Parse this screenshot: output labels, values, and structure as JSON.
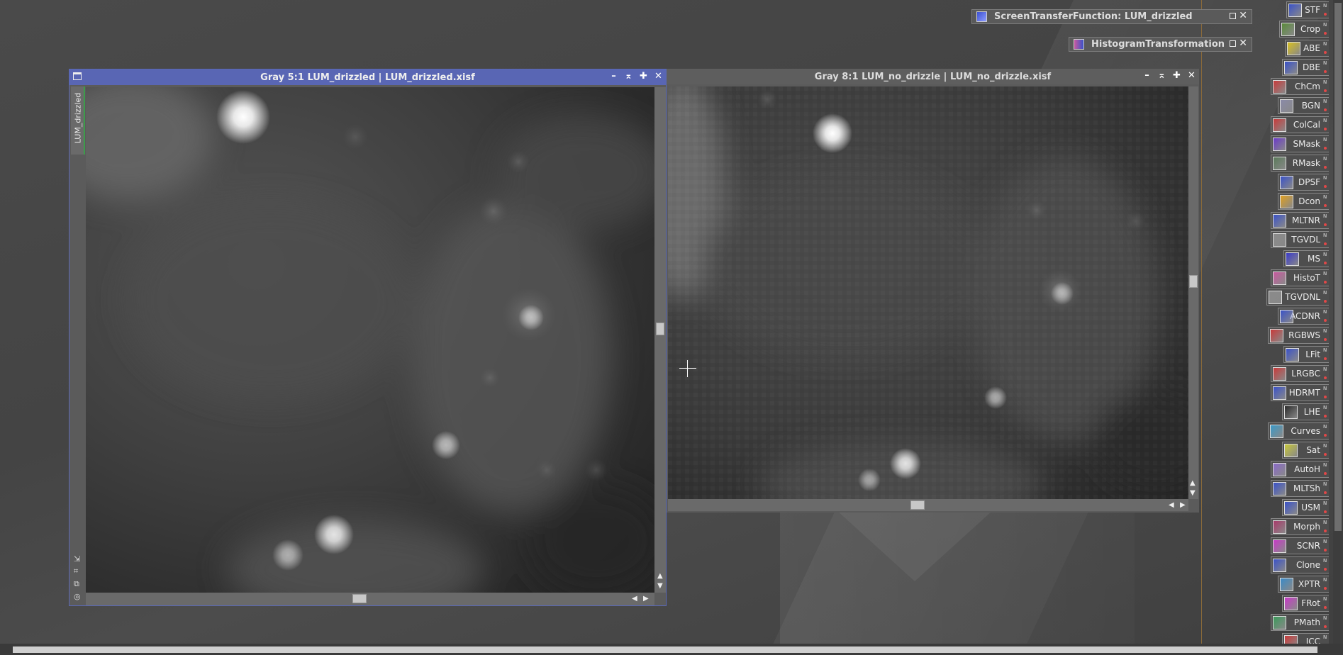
{
  "workspace": {
    "windows": [
      {
        "title": "Gray 5:1 LUM_drizzled | LUM_drizzled.xisf",
        "side_tab": "LUM_drizzled",
        "active": true
      },
      {
        "title": "Gray 8:1 LUM_no_drizzle | LUM_no_drizzle.xisf",
        "active": false
      }
    ],
    "floating_tools": [
      {
        "label": "ScreenTransferFunction: LUM_drizzled",
        "icon": "stf-icon"
      },
      {
        "label": "HistogramTransformation",
        "icon": "histogram-icon"
      }
    ],
    "controls": {
      "minimize": "–",
      "shade": "⌅",
      "maximize": "✚",
      "close": "✕"
    }
  },
  "process_icons": [
    {
      "label": "STF",
      "color": "#3a52c8"
    },
    {
      "label": "Crop",
      "color": "#5a8a3a"
    },
    {
      "label": "ABE",
      "color": "#d8c020"
    },
    {
      "label": "DBE",
      "color": "#3a52c8"
    },
    {
      "label": "ChCm",
      "color": "#c83a3a"
    },
    {
      "label": "BGN",
      "color": "#8a8aa8"
    },
    {
      "label": "ColCal",
      "color": "#c83a3a"
    },
    {
      "label": "SMask",
      "color": "#6a3ac8"
    },
    {
      "label": "RMask",
      "color": "#5a7a5a"
    },
    {
      "label": "DPSF",
      "color": "#3a52c8"
    },
    {
      "label": "Dcon",
      "color": "#e0a020"
    },
    {
      "label": "MLTNR",
      "color": "#3a52c8"
    },
    {
      "label": "TGVDL",
      "color": "#8a8a8a"
    },
    {
      "label": "MS",
      "color": "#3a3ac8"
    },
    {
      "label": "HistoT",
      "color": "#c85aa0"
    },
    {
      "label": "TGVDNL",
      "color": "#8a8a8a"
    },
    {
      "label": "ACDNR",
      "color": "#3a52c8"
    },
    {
      "label": "RGBWS",
      "color": "#c83a3a"
    },
    {
      "label": "LFit",
      "color": "#3a52c8"
    },
    {
      "label": "LRGBC",
      "color": "#c83a3a"
    },
    {
      "label": "HDRMT",
      "color": "#3a52c8"
    },
    {
      "label": "LHE",
      "color": "#2a2a2a"
    },
    {
      "label": "Curves",
      "color": "#3a9ac8"
    },
    {
      "label": "Sat",
      "color": "#c8c83a"
    },
    {
      "label": "AutoH",
      "color": "#8a6ac8"
    },
    {
      "label": "MLTSh",
      "color": "#3a52c8"
    },
    {
      "label": "USM",
      "color": "#3a52c8"
    },
    {
      "label": "Morph",
      "color": "#a83a6a"
    },
    {
      "label": "SCNR",
      "color": "#c83ac8"
    },
    {
      "label": "Clone",
      "color": "#3a52c8"
    },
    {
      "label": "XPTR",
      "color": "#3a8ac8"
    },
    {
      "label": "FRot",
      "color": "#c83ac8"
    },
    {
      "label": "PMath",
      "color": "#3a9a5a"
    },
    {
      "label": "ICC",
      "color": "#c83a3a"
    }
  ]
}
